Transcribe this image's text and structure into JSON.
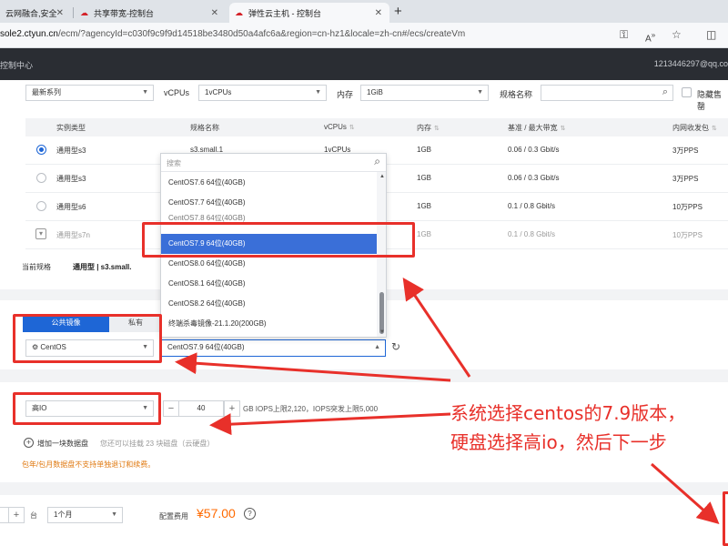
{
  "browser": {
    "tabs": [
      {
        "title": "云网融合,安全",
        "active": false
      },
      {
        "title": "共享带宽-控制台",
        "active": false
      },
      {
        "title": "弹性云主机 - 控制台",
        "active": true
      }
    ],
    "url_host": "sole2.ctyun.cn",
    "url_path": "/ecm/?agencyId=c030f9c9f9d14518be3480d50a4afc6a&region=cn-hz1&locale=zh-cn#/ecs/createVm"
  },
  "console": {
    "home_label": "控制中心",
    "account": "1213446297@qq.co"
  },
  "filters": {
    "series": "最新系列",
    "vcpus_label": "vCPUs",
    "vcpus": "1vCPUs",
    "memory_label": "内存",
    "memory": "1GiB",
    "spec_name_label": "规格名称",
    "hide_sold_out": "隐藏售罄"
  },
  "table": {
    "headers": [
      "实例类型",
      "规格名称",
      "vCPUs",
      "内存",
      "基准 / 最大带宽",
      "内网收发包"
    ],
    "rows": [
      {
        "type": "通用型s3",
        "spec": "s3.small.1",
        "vcpus": "1vCPUs",
        "mem": "1GB",
        "bw": "0.06 / 0.3 Gbit/s",
        "pps": "3万PPS",
        "state": "selected"
      },
      {
        "type": "通用型s3",
        "spec": "",
        "vcpus": "",
        "mem": "1GB",
        "bw": "0.06 / 0.3 Gbit/s",
        "pps": "3万PPS",
        "state": "normal"
      },
      {
        "type": "通用型s6",
        "spec": "",
        "vcpus": "",
        "mem": "1GB",
        "bw": "0.1 / 0.8 Gbit/s",
        "pps": "10万PPS",
        "state": "normal"
      },
      {
        "type": "通用型s7n",
        "spec": "",
        "vcpus": "",
        "mem": "1GB",
        "bw": "0.1 / 0.8 Gbit/s",
        "pps": "10万PPS",
        "state": "disabled"
      }
    ],
    "current_spec_label": "当前规格",
    "current_spec_value": "通用型 | s3.small."
  },
  "image": {
    "tab_public": "公共镜像",
    "tab_private": "私有",
    "os": "CentOS",
    "version": "CentOS7.9 64位(40GB)",
    "dropdown": {
      "search_placeholder": "搜索",
      "items": [
        "CentOS7.6 64位(40GB)",
        "CentOS7.7 64位(40GB)",
        "CentOS7.8 64位(40GB)",
        "CentOS7.9 64位(40GB)",
        "CentOS8.0 64位(40GB)",
        "CentOS8.1 64位(40GB)",
        "CentOS8.2 64位(40GB)",
        "终端杀毒镜像-21.1.20(200GB)"
      ],
      "selected_index": 3
    }
  },
  "disk": {
    "type": "高IO",
    "size": "40",
    "unit_hint": "GB IOPS上限2,120，IOPS突发上限5,000",
    "add_label": "增加一块数据盘",
    "add_hint": "您还可以挂载 23 块磁盘（云硬盘）",
    "warning": "包年/包月数据盘不支持单独退订和续费。"
  },
  "purchase": {
    "qty_unit": "台",
    "duration": "1个月",
    "price_label": "配置费用",
    "price": "¥57.00"
  },
  "annotation": {
    "line1": "系统选择centos的7.9版本，",
    "line2": "硬盘选择高io，然后下一步",
    "color": "#e8302a"
  }
}
